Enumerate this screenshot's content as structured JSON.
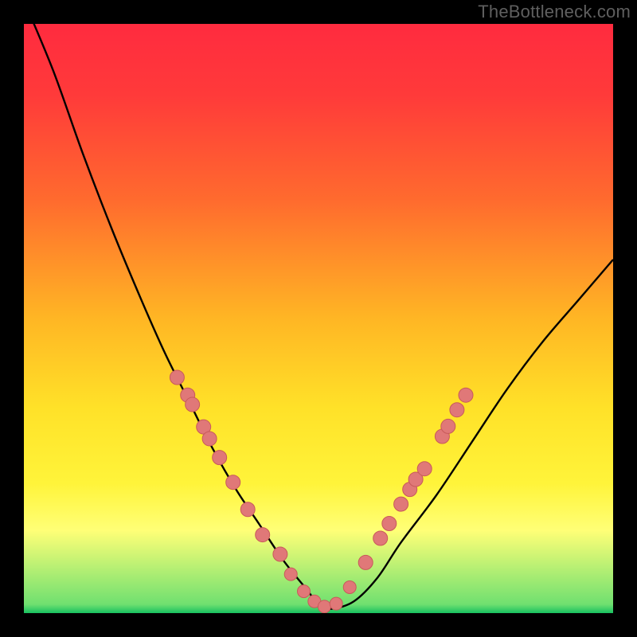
{
  "watermark": "TheBottleneck.com",
  "colors": {
    "black": "#000000",
    "curve": "#000000",
    "dot_fill": "#e07878",
    "dot_stroke": "#c85a5a",
    "gradient_stops": [
      {
        "offset": 0.0,
        "color": "#ff2b3f"
      },
      {
        "offset": 0.12,
        "color": "#ff3a3a"
      },
      {
        "offset": 0.3,
        "color": "#ff6b2e"
      },
      {
        "offset": 0.5,
        "color": "#ffb624"
      },
      {
        "offset": 0.65,
        "color": "#ffe128"
      },
      {
        "offset": 0.78,
        "color": "#fff43a"
      },
      {
        "offset": 0.86,
        "color": "#ffff77"
      },
      {
        "offset": 0.985,
        "color": "#70e070"
      },
      {
        "offset": 1.0,
        "color": "#18c060"
      }
    ]
  },
  "frame": {
    "outer_w": 800,
    "outer_h": 800,
    "border": 30,
    "inner_x": 30,
    "inner_y": 30,
    "inner_w": 740,
    "inner_h": 740
  },
  "chart_data": {
    "type": "line",
    "title": "",
    "xlabel": "",
    "ylabel": "",
    "xlim": [
      0,
      100
    ],
    "ylim": [
      0,
      100
    ],
    "grid": false,
    "series": [
      {
        "name": "bottleneck-curve",
        "x": [
          0,
          5,
          10,
          15,
          20,
          24,
          28,
          32,
          36,
          40,
          44,
          48,
          50,
          52,
          56,
          60,
          64,
          70,
          76,
          82,
          88,
          94,
          100
        ],
        "values": [
          104,
          92,
          78,
          65,
          53,
          44,
          36,
          28,
          21,
          15,
          9,
          4,
          1.5,
          0.7,
          2,
          6,
          12,
          20,
          29,
          38,
          46,
          53,
          60
        ]
      }
    ],
    "dots_left": {
      "name": "markers-left",
      "x": [
        26.0,
        27.8,
        28.6,
        30.5,
        31.5,
        33.2,
        35.5,
        38.0,
        40.5,
        43.5
      ],
      "values": [
        40.0,
        37.0,
        35.4,
        31.6,
        29.6,
        26.4,
        22.2,
        17.6,
        13.3,
        10.0
      ]
    },
    "dots_right": {
      "name": "markers-right",
      "x": [
        58.0,
        60.5,
        62.0,
        64.0,
        65.5,
        66.5,
        68.0,
        71.0,
        72.0,
        73.5,
        75.0
      ],
      "values": [
        8.6,
        12.7,
        15.2,
        18.5,
        21.0,
        22.7,
        24.5,
        30.0,
        31.7,
        34.5,
        37.0
      ]
    },
    "dots_bottom": {
      "name": "markers-bottom",
      "x": [
        45.3,
        47.5,
        49.3,
        51.0,
        53.0,
        55.3
      ],
      "values": [
        6.6,
        3.7,
        2.0,
        1.1,
        1.6,
        4.4
      ]
    }
  }
}
